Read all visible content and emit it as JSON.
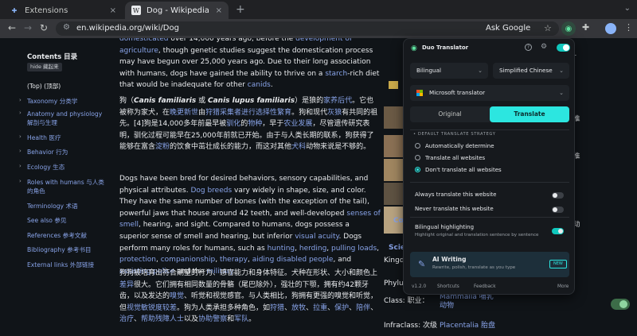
{
  "browser": {
    "tabs": [
      {
        "title": "Extensions",
        "active": false,
        "close": "×"
      },
      {
        "title": "Dog - Wikipedia",
        "active": true,
        "close": "×",
        "favicon": "W"
      }
    ],
    "new_tab": "+",
    "url": "en.wikipedia.org/wiki/Dog",
    "ask_google": "Ask Google"
  },
  "toc": {
    "title": "Contents 目录",
    "hide": "hide 藏起来",
    "items": [
      {
        "label": "(Top) (顶部)",
        "expandable": false
      },
      {
        "label": "Taxonomy 分类学",
        "expandable": true
      },
      {
        "label": "Anatomy and physiology 解剖与生理",
        "expandable": true
      },
      {
        "label": "Health 医疗",
        "expandable": true
      },
      {
        "label": "Behavior 行为",
        "expandable": true
      },
      {
        "label": "Ecology 生态",
        "expandable": true
      },
      {
        "label": "Roles with humans 与人类的角色",
        "expandable": true
      },
      {
        "label": "Terminology 术语",
        "expandable": false
      },
      {
        "label": "See also 参见",
        "expandable": false
      },
      {
        "label": "References 参考文献",
        "expandable": false
      },
      {
        "label": "Bibliography 参考书目",
        "expandable": false
      },
      {
        "label": "External links 外部链接",
        "expandable": false
      }
    ]
  },
  "article": {
    "p1": [
      {
        "t": "domesticated",
        "l": true
      },
      {
        "t": " over 14,000 years ago, before the ",
        "l": false
      },
      {
        "t": "development of agriculture",
        "l": true
      },
      {
        "t": ", though genetic studies suggest the domestication process may have begun over 25,000 years ago. Due to their long association with humans, dogs have gained the ability to thrive on a ",
        "l": false
      },
      {
        "t": "starch",
        "l": true
      },
      {
        "t": "-rich diet that would be inadequate for other ",
        "l": false
      },
      {
        "t": "canids",
        "l": true
      },
      {
        "t": ".",
        "l": false
      }
    ],
    "p1_cn": [
      {
        "t": "狗（",
        "l": false
      },
      {
        "t": "Canis familiaris",
        "l": false,
        "it": true
      },
      {
        "t": " 或 ",
        "l": false
      },
      {
        "t": "Canis lupus familiaris",
        "l": false,
        "it": true
      },
      {
        "t": "）是狼的",
        "l": false
      },
      {
        "t": "家养后代",
        "l": true
      },
      {
        "t": "。它也被称为家犬，在",
        "l": false
      },
      {
        "t": "晚更新世",
        "l": true
      },
      {
        "t": "由",
        "l": false
      },
      {
        "t": "狩猎采集者进行选择性繁育",
        "l": true
      },
      {
        "t": "。狗和现代",
        "l": false
      },
      {
        "t": "灰狼",
        "l": true
      },
      {
        "t": "有共同的祖先。[4]狗是14,000多年前最早被",
        "l": false
      },
      {
        "t": "驯化",
        "l": true
      },
      {
        "t": "的",
        "l": false
      },
      {
        "t": "物种",
        "l": true
      },
      {
        "t": "，早于",
        "l": false
      },
      {
        "t": "农业发展",
        "l": true
      },
      {
        "t": "，尽管遗传研究表明，驯化过程可能早在25,000年前就已开始。由于与人类长期的联系，狗获得了能够在富含",
        "l": false
      },
      {
        "t": "淀粉",
        "l": true
      },
      {
        "t": "的饮食中茁壮成长的能力，而这对其他",
        "l": false
      },
      {
        "t": "犬科",
        "l": true
      },
      {
        "t": "动物来说是不够的。",
        "l": false
      }
    ],
    "p2": [
      {
        "t": "Dogs have been bred for desired behaviors, sensory capabilities, and physical attributes. ",
        "l": false
      },
      {
        "t": "Dog breeds",
        "l": true
      },
      {
        "t": " vary widely in shape, size, and color. They have the same number of bones (with the exception of the tail), powerful jaws that house around 42 teeth, and well-developed ",
        "l": false
      },
      {
        "t": "senses of smell",
        "l": true
      },
      {
        "t": ", hearing, and sight. Compared to humans, dogs possess a superior sense of smell and hearing, but inferior ",
        "l": false
      },
      {
        "t": "visual acuity",
        "l": true
      },
      {
        "t": ". Dogs perform many roles for humans, such as ",
        "l": false
      },
      {
        "t": "hunting",
        "l": true
      },
      {
        "t": ", ",
        "l": false
      },
      {
        "t": "herding",
        "l": true
      },
      {
        "t": ", ",
        "l": false
      },
      {
        "t": "pulling loads",
        "l": true
      },
      {
        "t": ", ",
        "l": false
      },
      {
        "t": "protection",
        "l": true
      },
      {
        "t": ", ",
        "l": false
      },
      {
        "t": "companionship",
        "l": true
      },
      {
        "t": ", ",
        "l": false
      },
      {
        "t": "therapy",
        "l": true
      },
      {
        "t": ", ",
        "l": false
      },
      {
        "t": "aiding disabled people",
        "l": true
      },
      {
        "t": ", and ",
        "l": false
      },
      {
        "t": "assisting police",
        "l": true
      },
      {
        "t": " and the ",
        "l": false
      },
      {
        "t": "military",
        "l": true
      },
      {
        "t": ".",
        "l": false
      }
    ],
    "p2_cn": [
      {
        "t": "狗狗被培育出符合期望的行为、感官能力和身体特征。犬种在形状、大小和颜色上",
        "l": false
      },
      {
        "t": "差异",
        "l": true
      },
      {
        "t": "很大。它们拥有相同数量的骨骼（尾巴除外），强壮的下颚，拥有约42颗牙齿，以及发达的",
        "l": false
      },
      {
        "t": "嗅觉",
        "l": true
      },
      {
        "t": "、听觉和视觉感官。与人类相比，狗拥有更强的嗅觉和听觉，但",
        "l": false
      },
      {
        "t": "视觉敏锐度较差",
        "l": true
      },
      {
        "t": "。狗为人类承担多种角色，如",
        "l": false
      },
      {
        "t": "狩猎",
        "l": true
      },
      {
        "t": "、",
        "l": false
      },
      {
        "t": "放牧",
        "l": true
      },
      {
        "t": "、",
        "l": false
      },
      {
        "t": "拉重",
        "l": true
      },
      {
        "t": "、",
        "l": false
      },
      {
        "t": "保护",
        "l": true
      },
      {
        "t": "、",
        "l": false
      },
      {
        "t": "陪伴",
        "l": true
      },
      {
        "t": "、",
        "l": false
      },
      {
        "t": "治疗",
        "l": true
      },
      {
        "t": "、",
        "l": false
      },
      {
        "t": "帮助残障人士",
        "l": true
      },
      {
        "t": "以及",
        "l": false
      },
      {
        "t": "协助警察",
        "l": true
      },
      {
        "t": "和",
        "l": false
      },
      {
        "t": "军队",
        "l": true
      },
      {
        "t": "。",
        "l": false
      }
    ]
  },
  "infobox": {
    "co": "Co",
    "sci": "Scie",
    "kingdom": "Kingd",
    "phylum": "Phylu",
    "class_label": "Class: 职业：",
    "class_value": "Mammalia 哺乳动物",
    "infraclass_label": "Infraclass: 次级",
    "infraclass_value": "Placentalia 胎盘",
    "right_cn": [
      "r",
      "准",
      "准",
      "动"
    ]
  },
  "popup": {
    "title": "Duo Translator",
    "mode": "Bilingual",
    "target_lang": "Simplified Chinese",
    "translator": "Microsoft translator",
    "seg_original": "Original",
    "seg_translate": "Translate",
    "strategy_title": "• DEFAULT TRANSLATE STRATEGY",
    "strategies": [
      {
        "label": "Automatically determine",
        "selected": false
      },
      {
        "label": "Translate all websites",
        "selected": false
      },
      {
        "label": "Don't translate all websites",
        "selected": true
      }
    ],
    "always_translate": "Always translate this website",
    "never_translate": "Never translate this website",
    "bilingual_highlighting": "Bilingual highlighting",
    "bilingual_sub": "Highlight original and translation sentence by sentence",
    "ai_title": "AI Writing",
    "ai_sub": "Rewrite, polish, translate as you type",
    "ai_badge": "NEW",
    "version": "v1.2.0",
    "shortcuts": "Shortcuts",
    "feedback": "Feedback",
    "more": "More"
  },
  "colors": {
    "accent": "#2ce6e0",
    "link": "#88a3e8",
    "popup_bg": "#16191d"
  }
}
